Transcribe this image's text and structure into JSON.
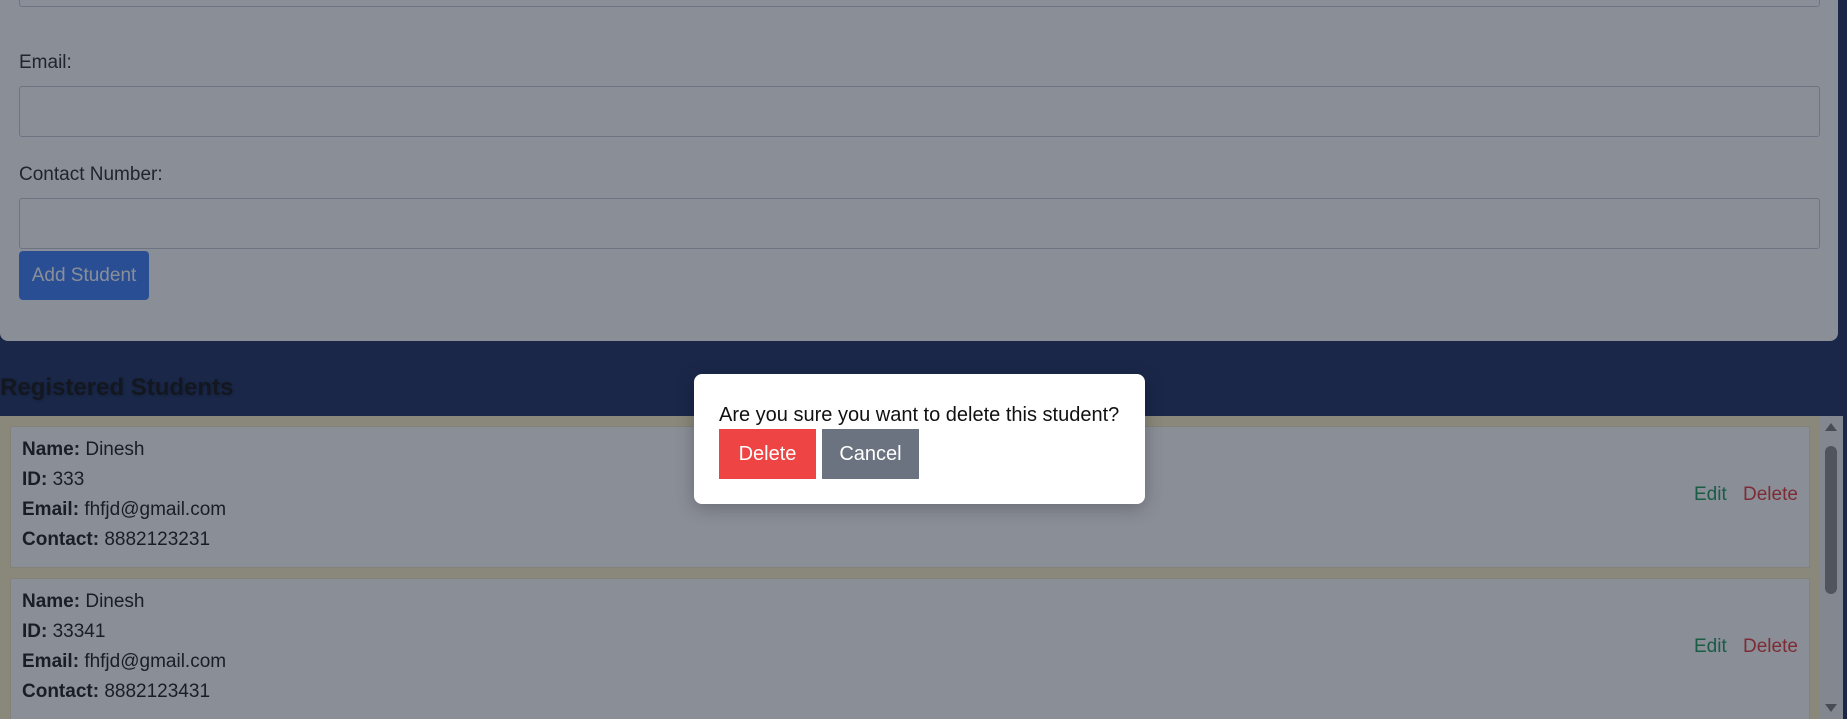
{
  "form": {
    "email_label": "Email:",
    "email_value": "",
    "contact_label": "Contact Number:",
    "contact_value": "",
    "add_button": "Add Student"
  },
  "list": {
    "title": "Registered Students",
    "field_labels": {
      "name": "Name:",
      "id": "ID:",
      "email": "Email:",
      "contact": "Contact:"
    },
    "students": [
      {
        "name": "Dinesh",
        "id": "333",
        "email": "fhfjd@gmail.com",
        "contact": "8882123231",
        "edit": "Edit",
        "delete": "Delete"
      },
      {
        "name": "Dinesh",
        "id": "33341",
        "email": "fhfjd@gmail.com",
        "contact": "8882123431",
        "edit": "Edit",
        "delete": "Delete"
      }
    ]
  },
  "modal": {
    "message": "Are you sure you want to delete this student?",
    "delete_button": "Delete",
    "cancel_button": "Cancel"
  },
  "colors": {
    "page_background": "#1e3163",
    "primary_button": "#3d7ef7",
    "danger_button": "#ef4444",
    "secondary_button": "#6b7280",
    "edit_link": "#1f9a5a",
    "delete_link": "#e53a3a",
    "list_background": "#fff3c4"
  }
}
